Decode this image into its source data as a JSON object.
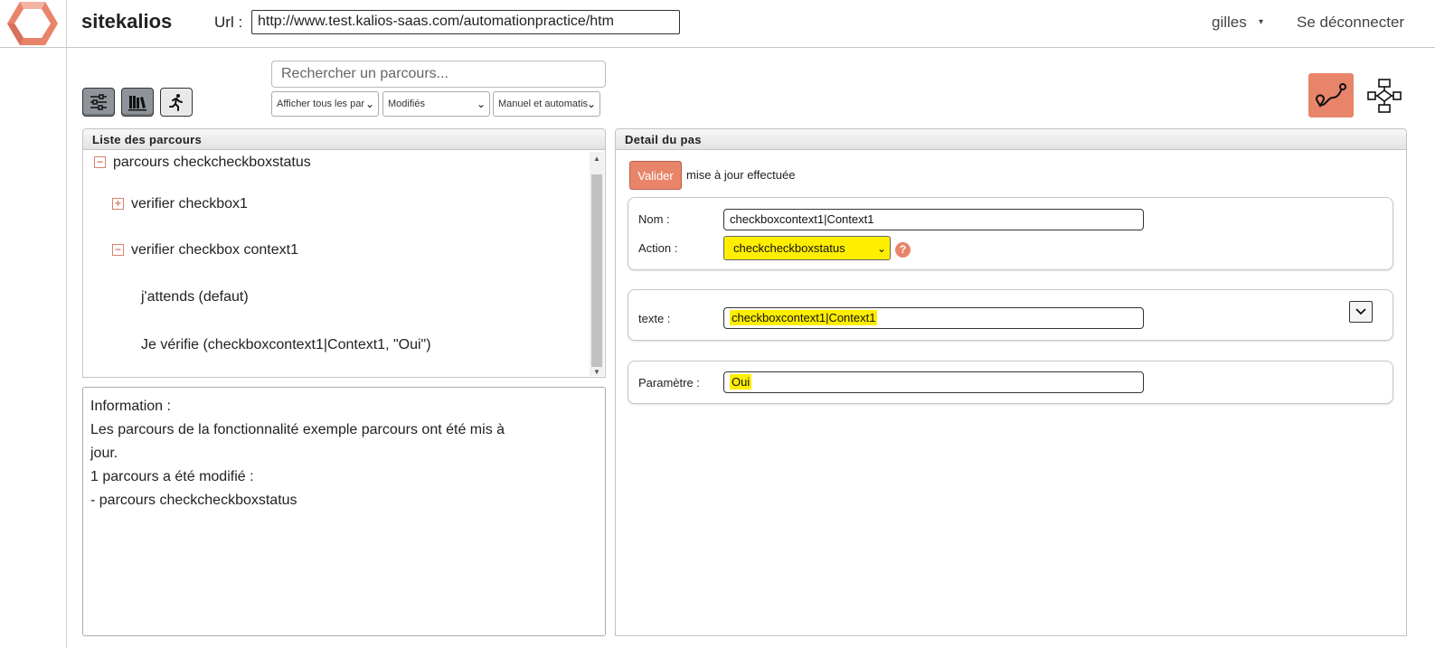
{
  "header": {
    "app_title": "sitekalios",
    "url_label": "Url :",
    "url_value": "http://www.test.kalios-saas.com/automationpractice/htm",
    "user_name": "gilles",
    "user_caret": "▾",
    "logout_label": "Se déconnecter"
  },
  "toolbar": {
    "search_placeholder": "Rechercher un parcours...",
    "filters": [
      {
        "selected": "Afficher tous les par"
      },
      {
        "selected": "Modifiés"
      },
      {
        "selected": "Manuel et automatis"
      }
    ],
    "icons": [
      "filter-sliders-icon",
      "library-books-icon",
      "runner-icon",
      "route-map-icon",
      "flowchart-icon"
    ]
  },
  "list_panel": {
    "title": "Liste des parcours",
    "tree": [
      {
        "toggle": "−",
        "label": "parcours checkcheckboxstatus"
      },
      {
        "toggle": "+",
        "label": "verifier checkbox1"
      },
      {
        "toggle": "−",
        "label": "verifier checkbox context1"
      },
      {
        "label": "j'attends (defaut)"
      },
      {
        "label": "Je vérifie (checkboxcontext1|Context1, \"Oui\")"
      }
    ]
  },
  "info": {
    "lines": [
      "Information :",
      "Les parcours de la fonctionnalité exemple parcours ont été mis à",
      "jour.",
      "1 parcours a été modifié :",
      "- parcours checkcheckboxstatus"
    ]
  },
  "detail_panel": {
    "title": "Detail du pas",
    "validate_label": "Valider",
    "status_message": "mise à jour effectuée",
    "name_label": "Nom :",
    "name_value": "checkboxcontext1|Context1",
    "action_label": "Action :",
    "action_value": "checkcheckboxstatus",
    "help_glyph": "?",
    "text_label": "texte :",
    "text_value": "checkboxcontext1|Context1",
    "param_label": "Paramètre :",
    "param_value": "Oui"
  },
  "colors": {
    "accent": "#e8846a",
    "highlight": "#ffee00",
    "tool_button": "#8e9499"
  }
}
